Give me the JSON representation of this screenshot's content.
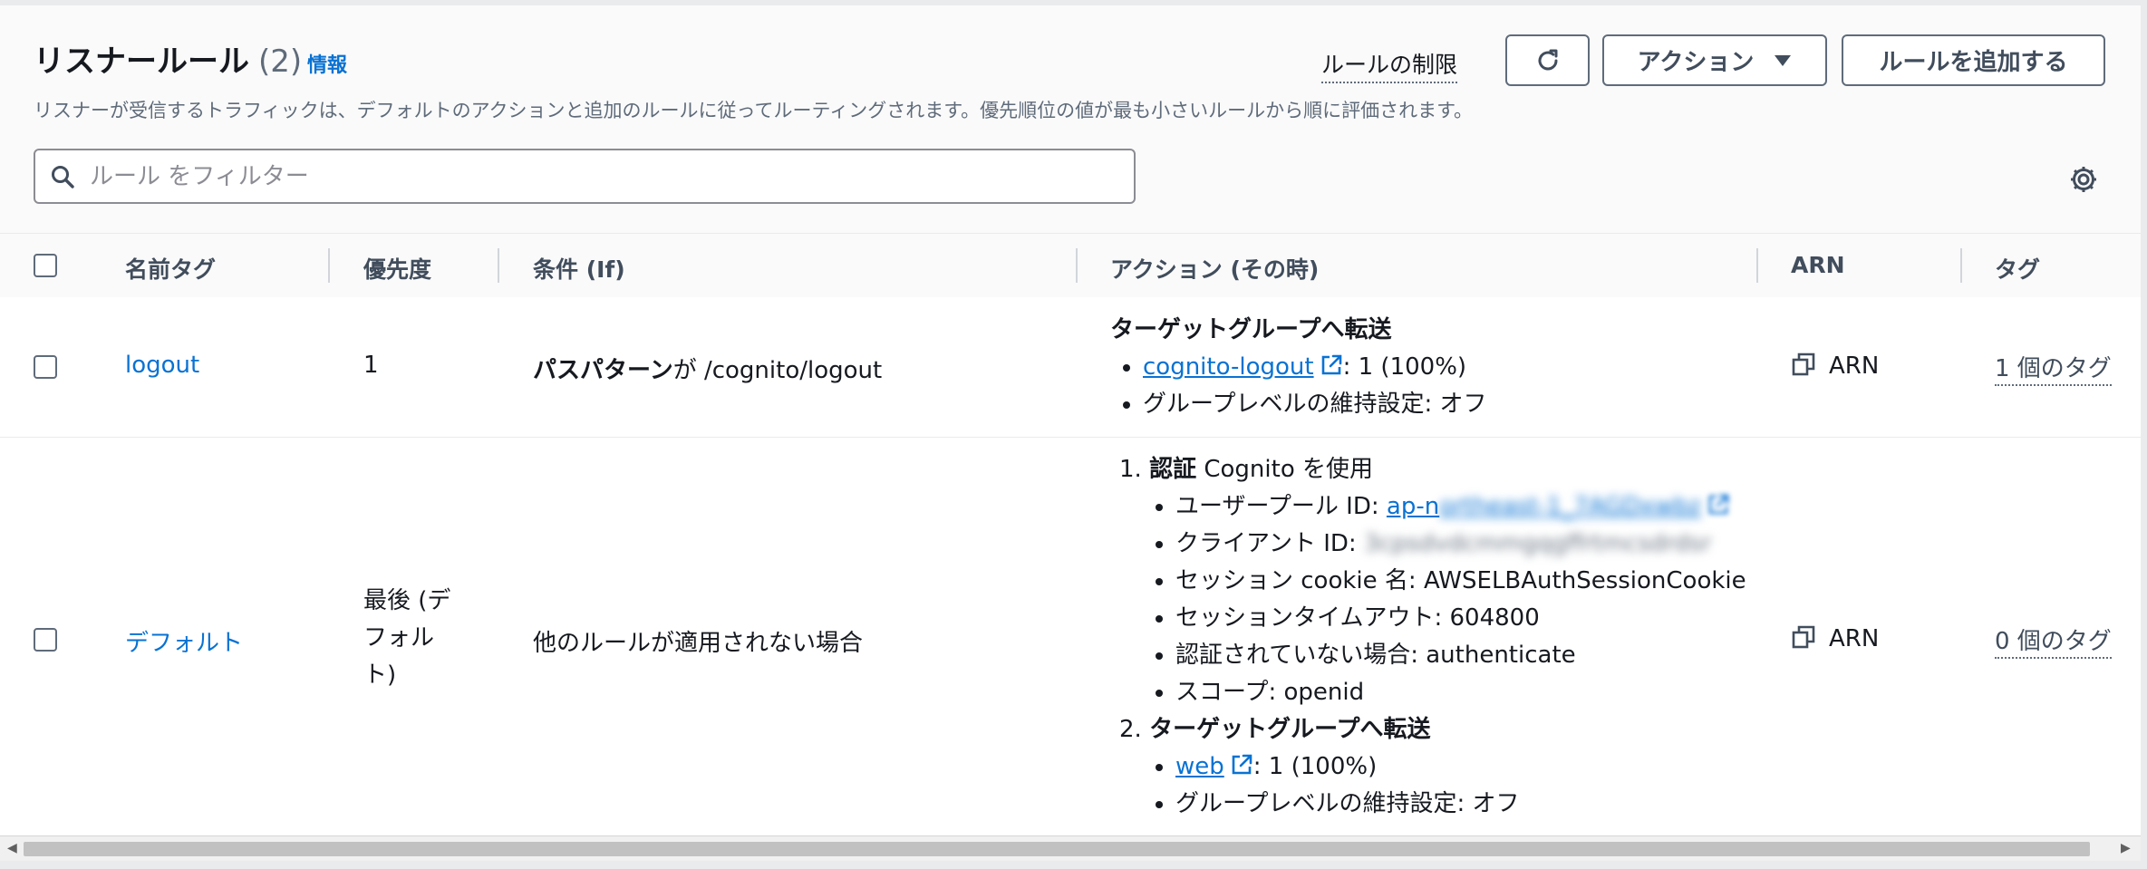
{
  "header": {
    "title": "リスナールール",
    "count": "(2)",
    "info": "情報",
    "description": "リスナーが受信するトラフィックは、デフォルトのアクションと追加のルールに従ってルーティングされます。優先順位の値が最も小さいルールから順に評価されます。",
    "limits_link": "ルールの制限",
    "actions_label": "アクション",
    "add_rule_label": "ルールを追加する"
  },
  "search": {
    "placeholder": "ルール をフィルター"
  },
  "columns": {
    "name_tag": "名前タグ",
    "priority": "優先度",
    "conditions": "条件 (If)",
    "actions": "アクション (その時)",
    "arn": "ARN",
    "tags": "タグ"
  },
  "rows": [
    {
      "name": "logout",
      "priority": "1",
      "condition_bold": "パスパターン",
      "condition_rest": "が /cognito/logout",
      "action_heading": "ターゲットグループへ転送",
      "target_group": "cognito-logout",
      "target_weight": ": 1 (100%)",
      "stickiness": "グループレベルの維持設定: オフ",
      "arn_label": "ARN",
      "tags": "1 個のタグ"
    },
    {
      "name": "デフォルト",
      "priority_lines": [
        "最後 (デ",
        "フォル",
        "ト)"
      ],
      "condition": "他のルールが適用されない場合",
      "auth_num": "1.",
      "auth_heading": "認証",
      "auth_heading_rest": " Cognito を使用",
      "user_pool_label": "ユーザープール ID: ",
      "user_pool_visible": "ap-n",
      "user_pool_blurred": "ortheast-1_7AGDxwbz",
      "client_id_label": "クライアント ID: ",
      "client_id_blurred": "3cpsdvdcmmgqgffrtmcsdrdsr",
      "session_cookie": "セッション cookie 名: AWSELBAuthSessionCookie",
      "session_timeout": "セッションタイムアウト: 604800",
      "unauthenticated": "認証されていない場合: authenticate",
      "scope": "スコープ: openid",
      "forward_num": "2.",
      "forward_heading": "ターゲットグループへ転送",
      "target_group": "web",
      "target_weight": ": 1 (100%)",
      "stickiness": "グループレベルの維持設定: オフ",
      "arn_label": "ARN",
      "tags": "0 個のタグ"
    }
  ],
  "icons": {
    "search": "search-icon",
    "refresh": "refresh-icon",
    "caret": "caret-down-icon",
    "settings": "gear-icon",
    "external": "external-link-icon",
    "copy": "copy-icon"
  },
  "colors": {
    "link": "#0972d3",
    "text": "#16191f",
    "secondary": "#5f6b7a"
  }
}
